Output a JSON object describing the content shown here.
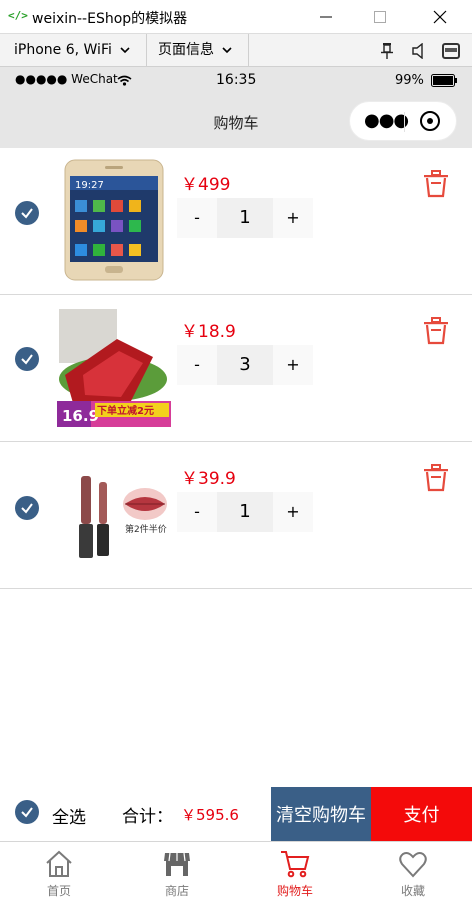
{
  "window": {
    "title": "weixin--EShop的模拟器",
    "icon_label": "</>",
    "buttons": [
      "minimize",
      "maximize",
      "close"
    ]
  },
  "toolbar": {
    "device": "iPhone 6, WiFi",
    "page_info": "页面信息"
  },
  "statusbar": {
    "carrier": "●●●●● WeChat",
    "time": "16:35",
    "battery": "99%"
  },
  "navbar": {
    "title": "购物车"
  },
  "colors": {
    "accent": "#3a5f87",
    "price": "#e6000f",
    "pay": "#f40a0a",
    "tab_active": "#e21f1f"
  },
  "cart": {
    "items": [
      {
        "name": "smartphone",
        "price": "￥499",
        "quantity": "1",
        "minus": "-",
        "plus": "+",
        "checked": true
      },
      {
        "name": "pork jerky",
        "price": "￥18.9",
        "quantity": "3",
        "minus": "-",
        "plus": "+",
        "checked": true
      },
      {
        "name": "lip gloss",
        "price": "￥39.9",
        "quantity": "1",
        "minus": "-",
        "plus": "+",
        "checked": true
      }
    ]
  },
  "summary": {
    "select_all": "全选",
    "total_label": "合计：",
    "total_value": "￥595.6",
    "clear_button": "清空购物车",
    "pay_button": "支付"
  },
  "tabs": [
    {
      "label": "首页",
      "icon": "home-icon",
      "active": false
    },
    {
      "label": "商店",
      "icon": "store-icon",
      "active": false
    },
    {
      "label": "购物车",
      "icon": "cart-icon",
      "active": true
    },
    {
      "label": "收藏",
      "icon": "heart-icon",
      "active": false
    }
  ],
  "product_images": {
    "jerky_badge_price": "16.9",
    "jerky_banner": "下单立减2元",
    "lipgloss_badge": "第2件半价"
  }
}
